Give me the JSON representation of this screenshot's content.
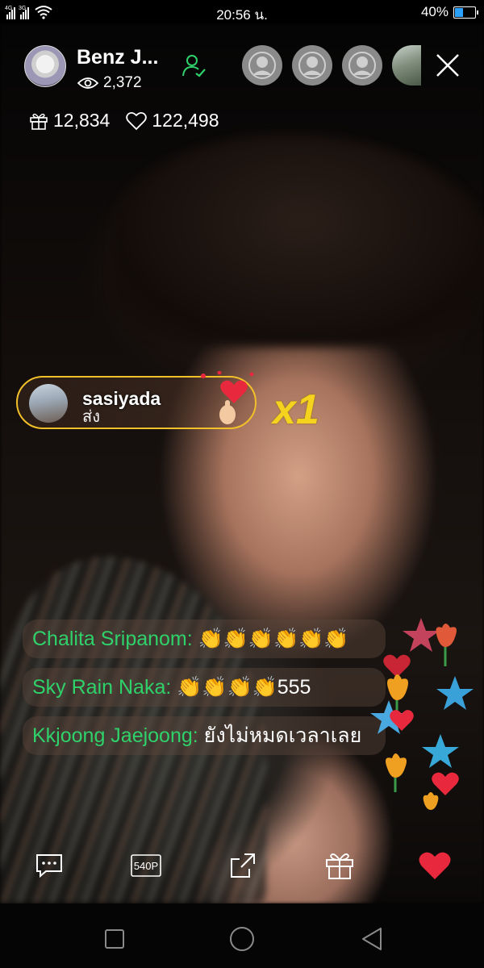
{
  "status_bar": {
    "network_1": "4G",
    "network_2": "3G",
    "time": "20:56 น.",
    "battery_percent": "40%",
    "battery_level": 0.4
  },
  "host": {
    "name": "Benz J...",
    "viewers": "2,372",
    "gifts_count": "12,834",
    "likes_count": "122,498"
  },
  "gift_notification": {
    "user": "sasiyada",
    "action": "ส่ง",
    "count": "x1"
  },
  "chat": [
    {
      "user": "Chalita Sripanom:",
      "text": " 👏👏👏👏👏👏"
    },
    {
      "user": "Sky Rain Naka:",
      "text": " 👏👏👏👏555"
    },
    {
      "user": "Kkjoong Jaejoong:",
      "text": " ยังไม่หมดเวลาเลย"
    }
  ],
  "bottom_bar": {
    "quality_label": "540P"
  },
  "colors": {
    "accent_green": "#2fd26a",
    "heart_red": "#e8283c",
    "gift_border": "#f2c028",
    "gift_count": "#f5d21d"
  },
  "icons": [
    "comment-icon",
    "quality-icon",
    "share-icon",
    "gift-icon",
    "like-heart-icon"
  ]
}
